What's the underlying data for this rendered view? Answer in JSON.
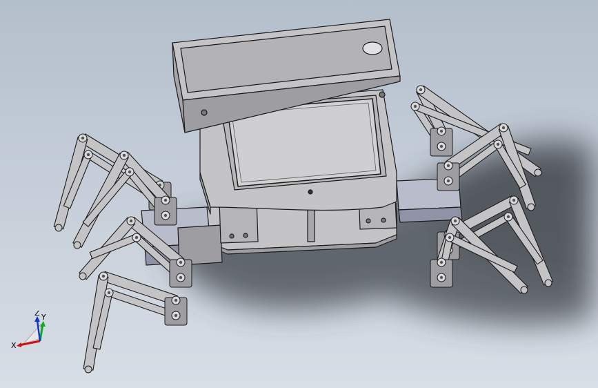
{
  "viewport": {
    "background_top": "#b4bfcc",
    "background_bottom": "#d8dee6"
  },
  "model": {
    "part_color": "#c4c4c6",
    "part_shade": "#9d9da2",
    "edge_color": "#1a1a1a",
    "servo_color": "#b9bccb",
    "servo_shade": "#8f93a5",
    "shadow_color": "#3e434a",
    "leg_count": 6
  },
  "triad": {
    "x_label": "X",
    "y_label": "Y",
    "z_label": "Z",
    "x_color": "#cc1111",
    "y_color": "#11aa22",
    "z_color": "#1133cc"
  }
}
